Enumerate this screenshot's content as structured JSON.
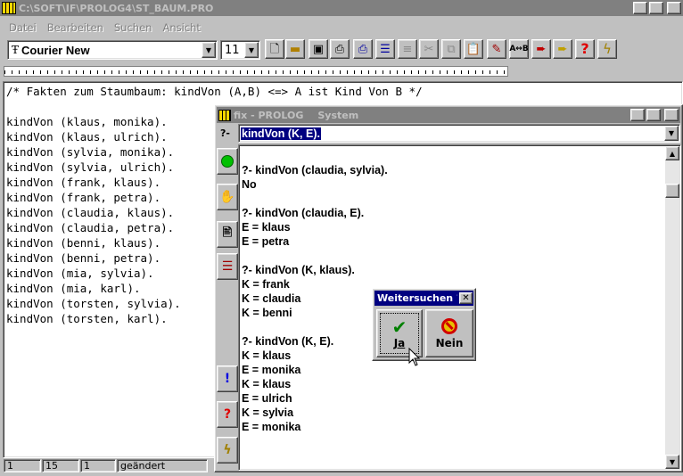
{
  "main_window": {
    "title": "C:\\SOFT\\IF\\PROLOG4\\ST_BAUM.PRO"
  },
  "menu": [
    "Datei",
    "Bearbeiten",
    "Suchen",
    "Ansicht"
  ],
  "toolbar": {
    "font_name": "Courier New",
    "font_size": "11"
  },
  "editor": {
    "comment": "/* Fakten zum Staumbaum: kindVon (A,B) <=> A ist Kind Von B */",
    "facts": [
      "kindVon (klaus, monika).",
      "kindVon (klaus, ulrich).",
      "kindVon (sylvia, monika).",
      "kindVon (sylvia, ulrich).",
      "kindVon (frank, klaus).",
      "kindVon (frank, petra).",
      "kindVon (claudia, klaus).",
      "kindVon (claudia, petra).",
      "kindVon (benni, klaus).",
      "kindVon (benni, petra).",
      "kindVon (mia, sylvia).",
      "kindVon (mia, karl).",
      "kindVon (torsten, sylvia).",
      "kindVon (torsten, karl)."
    ]
  },
  "prolog_window": {
    "title": "fix - PROLOG",
    "menu": "System",
    "prompt": "?-",
    "query": "kindVon (K, E).",
    "output": [
      "?- kindVon (claudia, sylvia).",
      "No",
      "",
      "?- kindVon (claudia, E).",
      "E = klaus",
      "E = petra",
      "",
      "?- kindVon (K, klaus).",
      "K = frank",
      "K = claudia",
      "K = benni",
      "",
      "?- kindVon (K, E).",
      "K = klaus",
      "E = monika",
      "K = klaus",
      "E = ulrich",
      "K = sylvia",
      "E = monika"
    ]
  },
  "dialog": {
    "title": "Weitersuchen ?",
    "yes_label": "Ja",
    "no_label": "Nein"
  },
  "statusbar": {
    "line": "1",
    "column": "15",
    "page": "1",
    "state": "geändert"
  },
  "colors": {
    "titlebar_inactive": "#808080",
    "desktop": "#c0c0c0",
    "go_green": "#00c000",
    "help_red": "#e00000",
    "info_blue": "#0000e0"
  }
}
